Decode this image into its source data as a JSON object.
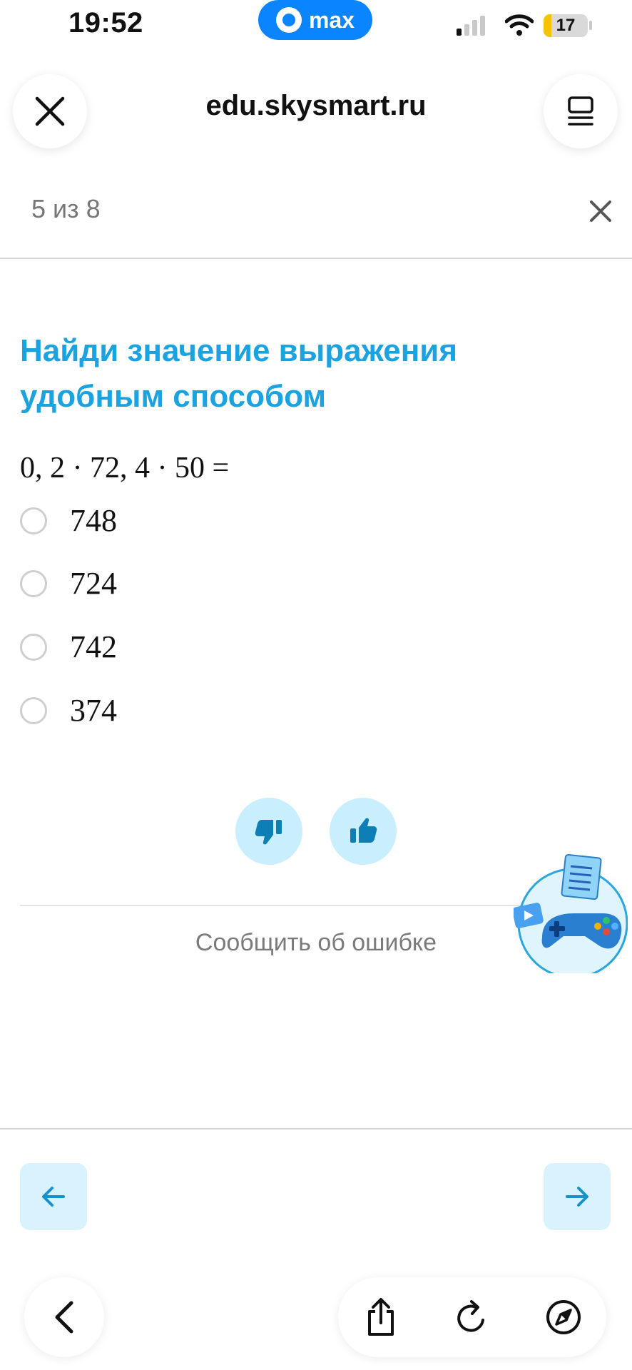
{
  "status_bar": {
    "time": "19:52",
    "app_pill_label": "max",
    "battery_level": "17",
    "signal_bars_on": 1,
    "signal_bars_total": 4
  },
  "browser": {
    "url": "edu.skysmart.ru",
    "close_icon": "close-icon",
    "menu_icon": "menu-icon"
  },
  "task": {
    "progress": "5 из 8",
    "title": "Найди значение выражения удобным способом",
    "expression": "0, 2 · 72, 4 · 50 =",
    "options": [
      {
        "label": "748",
        "selected": false
      },
      {
        "label": "724",
        "selected": false
      },
      {
        "label": "742",
        "selected": false
      },
      {
        "label": "374",
        "selected": false
      }
    ],
    "report_label": "Сообщить об ошибке"
  },
  "colors": {
    "accent": "#1aa3e0",
    "vote_bg": "#c9efff",
    "nav_bg": "#d8f3fd",
    "app_pill": "#0a84ff"
  },
  "icons": {
    "dislike": "thumbs-down-icon",
    "like": "thumbs-up-icon",
    "prev": "arrow-left-icon",
    "next": "arrow-right-icon",
    "safari_back": "chevron-left-icon",
    "share": "share-icon",
    "reload": "reload-icon",
    "compass": "compass-icon"
  }
}
